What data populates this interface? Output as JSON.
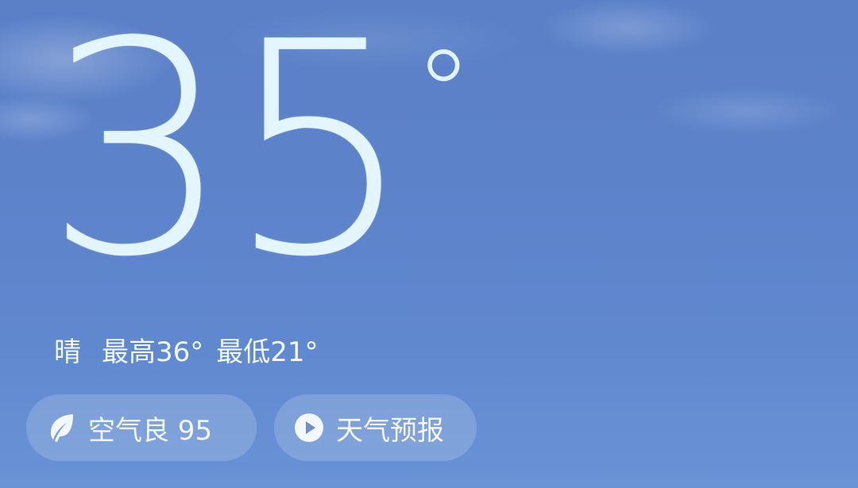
{
  "current": {
    "temperature": "35",
    "degree_symbol": "°"
  },
  "summary": {
    "condition": "晴",
    "high": "最高36°",
    "low": "最低21°"
  },
  "air_quality": {
    "label": "空气良 95",
    "icon": "leaf-icon"
  },
  "forecast": {
    "label": "天气预报",
    "icon": "play-icon"
  },
  "colors": {
    "sky_top": "#5b80c8",
    "sky_bottom": "#6a93d6",
    "text": "#e9f7ff"
  }
}
